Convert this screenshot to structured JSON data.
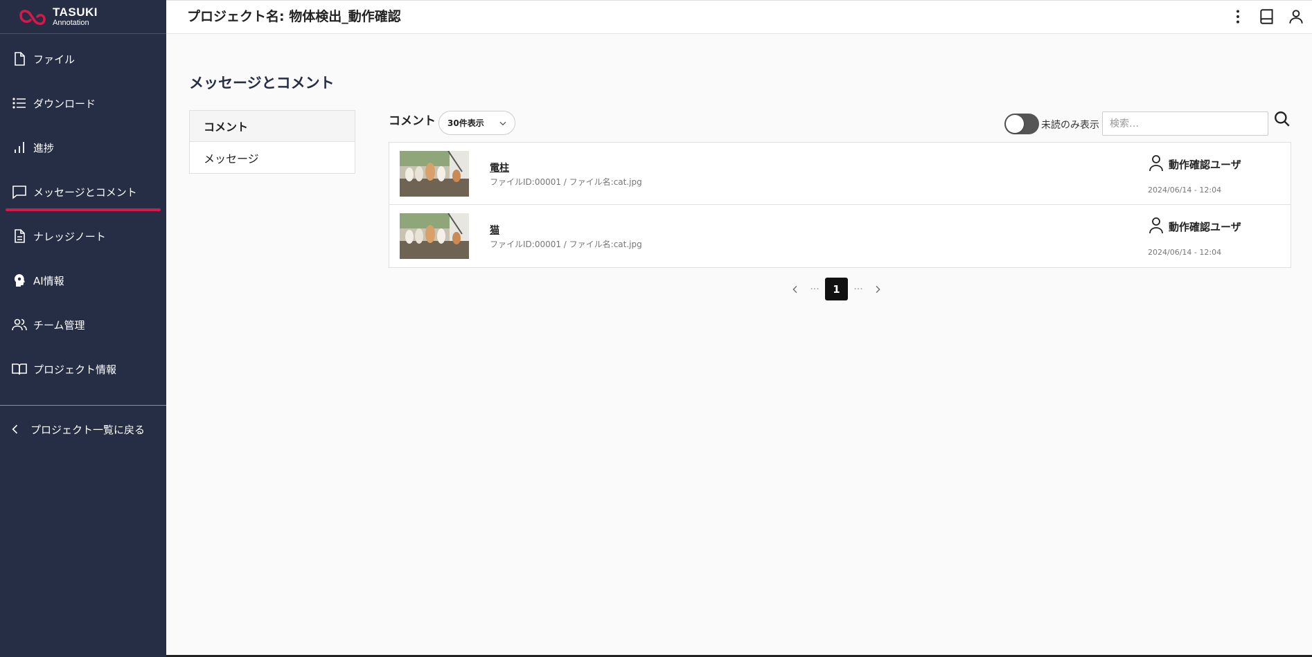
{
  "brand": {
    "name": "TASUKI",
    "sub": "Annotation",
    "accent": "#d9184a",
    "sidebar_bg": "#262e45"
  },
  "header": {
    "title": "プロジェクト名: 物体検出_動作確認",
    "icons": [
      "more-vert-icon",
      "book-icon",
      "user-icon"
    ]
  },
  "sidebar": {
    "items": [
      {
        "label": "ファイル",
        "icon": "file-icon"
      },
      {
        "label": "ダウンロード",
        "icon": "list-icon"
      },
      {
        "label": "進捗",
        "icon": "bar-chart-icon"
      },
      {
        "label": "メッセージとコメント",
        "icon": "message-icon",
        "active": true
      },
      {
        "label": "ナレッジノート",
        "icon": "note-icon"
      },
      {
        "label": "AI情報",
        "icon": "ai-head-icon"
      },
      {
        "label": "チーム管理",
        "icon": "team-icon"
      },
      {
        "label": "プロジェクト情報",
        "icon": "open-book-icon"
      }
    ],
    "back_label": "プロジェクト一覧に戻る"
  },
  "main": {
    "page_title": "メッセージとコメント",
    "tabs": [
      {
        "label": "コメント",
        "active": true
      },
      {
        "label": "メッセージ",
        "active": false
      }
    ],
    "toolbar": {
      "label": "コメント",
      "per_page": "30件表示",
      "unread_only_label": "未読のみ表示",
      "unread_only": true,
      "search_placeholder": "検索…"
    },
    "comments": [
      {
        "title": "電柱",
        "meta": "ファイルID:00001 / ファイル名:cat.jpg",
        "user": "動作確認ユーザ",
        "date": "2024/06/14 - 12:04"
      },
      {
        "title": "猫",
        "meta": "ファイルID:00001 / ファイル名:cat.jpg",
        "user": "動作確認ユーザ",
        "date": "2024/06/14 - 12:04"
      }
    ],
    "pagination": {
      "current": "1",
      "ellipsis": "···"
    }
  }
}
